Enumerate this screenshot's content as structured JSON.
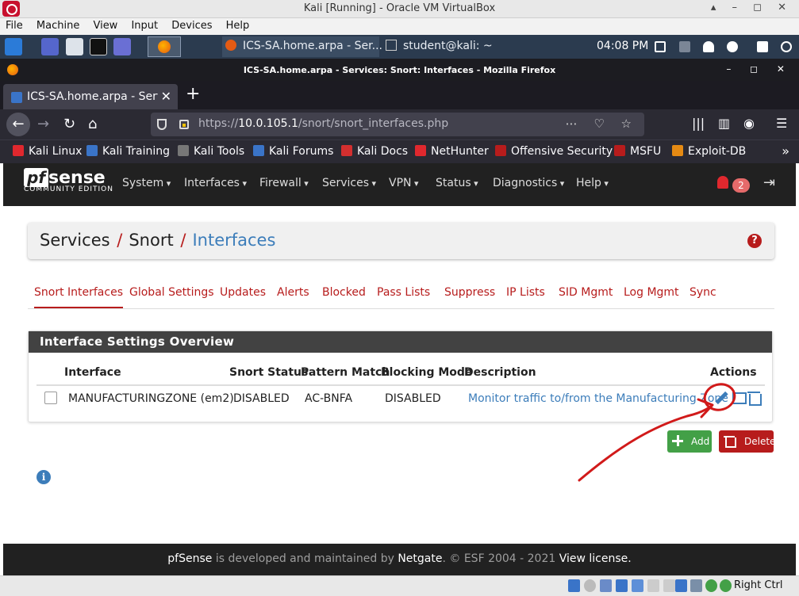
{
  "vbox": {
    "title": "Kali [Running] - Oracle VM VirtualBox",
    "menu": [
      "File",
      "Machine",
      "View",
      "Input",
      "Devices",
      "Help"
    ],
    "host_key": "Right Ctrl"
  },
  "taskbar": {
    "task1": "ICS-SA.home.arpa - Ser...",
    "task2": "student@kali: ~",
    "clock": "04:08 PM"
  },
  "firefox": {
    "window_title": "ICS-SA.home.arpa - Services: Snort: Interfaces - Mozilla Firefox",
    "tab_title": "ICS-SA.home.arpa - Services: Snort: Interfaces",
    "url_prefix": "https://",
    "url_host": "10.0.105.1",
    "url_path": "/snort/snort_interfaces.php",
    "bookmarks": [
      "Kali Linux",
      "Kali Training",
      "Kali Tools",
      "Kali Forums",
      "Kali Docs",
      "NetHunter",
      "Offensive Security",
      "MSFU",
      "Exploit-DB"
    ]
  },
  "pfsense": {
    "logo_pf": "pf",
    "logo_sense": "sense",
    "logo_edition": "COMMUNITY EDITION",
    "menu": [
      "System",
      "Interfaces",
      "Firewall",
      "Services",
      "VPN",
      "Status",
      "Diagnostics",
      "Help"
    ],
    "notification_count": "2"
  },
  "page": {
    "breadcrumb": [
      "Services",
      "Snort",
      "Interfaces"
    ],
    "tabs": [
      "Snort Interfaces",
      "Global Settings",
      "Updates",
      "Alerts",
      "Blocked",
      "Pass Lists",
      "Suppress",
      "IP Lists",
      "SID Mgmt",
      "Log Mgmt",
      "Sync"
    ],
    "active_tab": 0,
    "panel_title": "Interface Settings Overview",
    "columns": [
      "Interface",
      "Snort Status",
      "Pattern Match",
      "Blocking Mode",
      "Description",
      "Actions"
    ],
    "rows": [
      {
        "interface": "MANUFACTURINGZONE (em2)",
        "status": "DISABLED",
        "pattern": "AC-BNFA",
        "blocking": "DISABLED",
        "description": "Monitor traffic to/from the Manufacturing Zone"
      }
    ],
    "add_label": "Add",
    "delete_label": "Delete"
  },
  "footer": {
    "p1": "pfSense",
    "p2": " is developed and maintained by ",
    "p3": "Netgate",
    "p4": ". © ESF 2004 - 2021 ",
    "p5": "View license."
  },
  "colors": {
    "pfsense_red": "#b71c1c",
    "pfsense_blue": "#3c7dba",
    "pfsense_dark": "#212121",
    "add_green": "#43a047",
    "annotation_red": "#d11a1a"
  }
}
